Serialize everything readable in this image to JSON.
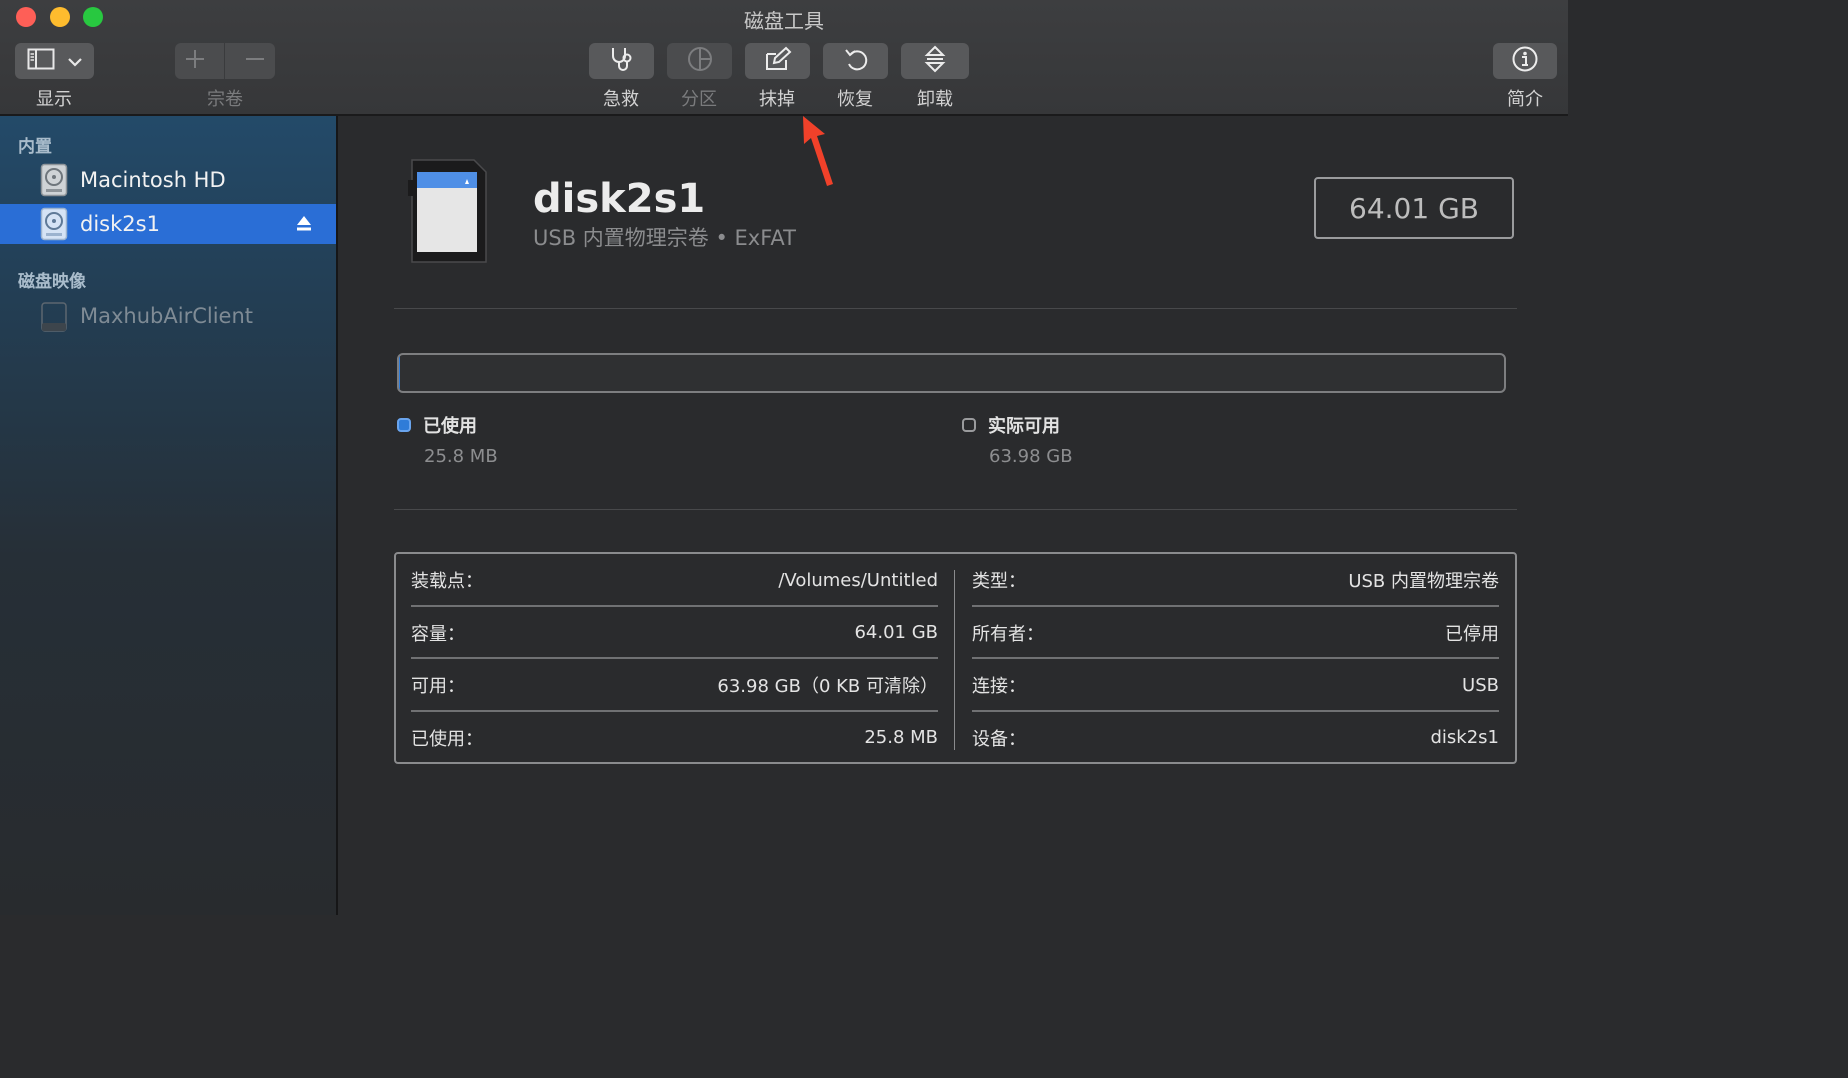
{
  "window": {
    "title": "磁盘工具"
  },
  "toolbar": {
    "view_label": "显示",
    "volume_label": "宗卷",
    "firstaid_label": "急救",
    "partition_label": "分区",
    "erase_label": "抹掉",
    "restore_label": "恢复",
    "unmount_label": "卸载",
    "info_label": "简介"
  },
  "sidebar": {
    "section_internal": "内置",
    "section_images": "磁盘映像",
    "items": [
      {
        "label": "Macintosh HD"
      },
      {
        "label": "disk2s1"
      },
      {
        "label": "MaxhubAirClient"
      }
    ]
  },
  "volume": {
    "name": "disk2s1",
    "subtitle": "USB 内置物理宗卷 • ExFAT",
    "capacity": "64.01 GB",
    "used_fraction": 0.0004
  },
  "legend": {
    "used_label": "已使用",
    "used_value": "25.8 MB",
    "free_label": "实际可用",
    "free_value": "63.98 GB"
  },
  "info": {
    "left": [
      {
        "key": "装载点：",
        "value": "/Volumes/Untitled"
      },
      {
        "key": "容量：",
        "value": "64.01 GB"
      },
      {
        "key": "可用：",
        "value": "63.98 GB（0 KB 可清除）"
      },
      {
        "key": "已使用：",
        "value": "25.8 MB"
      }
    ],
    "right": [
      {
        "key": "类型：",
        "value": "USB 内置物理宗卷"
      },
      {
        "key": "所有者：",
        "value": "已停用"
      },
      {
        "key": "连接：",
        "value": "USB"
      },
      {
        "key": "设备：",
        "value": "disk2s1"
      }
    ]
  },
  "colors": {
    "selection": "#2a6ed6",
    "used": "#2f7cd8",
    "annotation_arrow": "#f0412a"
  },
  "icons": {
    "view": "sidebar-toggle-icon",
    "firstaid": "stethoscope-icon",
    "partition": "pie-icon",
    "erase": "pencil-square-icon",
    "restore": "undo-icon",
    "unmount": "unmount-icon",
    "info": "info-icon"
  }
}
